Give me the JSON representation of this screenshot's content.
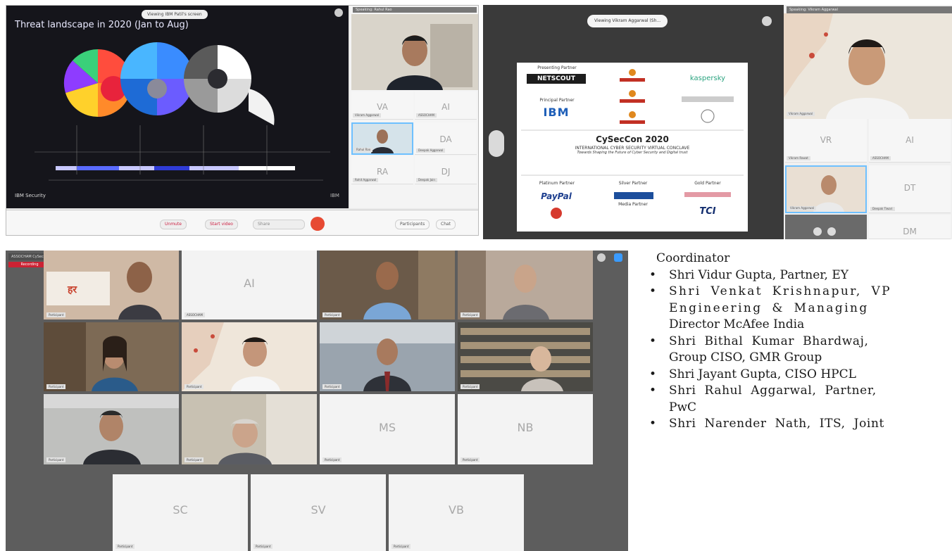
{
  "screenshot1": {
    "viewing_pill": "Viewing IBM Patil's screen",
    "slide_title": "Threat landscape in 2020 (Jan to Aug)",
    "slide_footer": "IBM Security",
    "slide_brand": "IBM",
    "side_header": "Speaking: Rahul Rao",
    "tiles": [
      {
        "initials": "VA",
        "name": "Vikram Aggarwal"
      },
      {
        "initials": "AI",
        "name": "ASSOCHAM"
      },
      {
        "initials": "",
        "name": "Rahul Rao"
      },
      {
        "initials": "DA",
        "name": "Deepak Aggarwal"
      },
      {
        "initials": "RA",
        "name": "Rohit Aggarwal"
      },
      {
        "initials": "DJ",
        "name": "Deepak Jain"
      }
    ],
    "toolbar": {
      "mute": "Unmute",
      "video": "Start video",
      "share": "Share",
      "participants": "Participants",
      "chat": "Chat"
    }
  },
  "screenshot2": {
    "viewing_pill": "Viewing Vikram Aggarwal (Sh...",
    "speaking": "Speaking: Vikram Aggarwal",
    "poster": {
      "row_heads": [
        "Presenting Partner",
        "Principal Partner",
        "Platinum Partner",
        "Gold Partner",
        "Silver Partner",
        "Media Partner"
      ],
      "sponsor_logos": [
        "NETSCOUT",
        "kaspersky",
        "IBM",
        "PayPal",
        "TCI"
      ],
      "event_title": "CySecCon 2020",
      "event_subtitle": "INTERNATIONAL CYBER SECURITY VIRTUAL CONCLAVE",
      "event_tagline": "Towards Shaping the Future of Cyber Security and Digital trust"
    },
    "tiles": [
      {
        "initials": "",
        "name": "Vikram Aggarwal"
      },
      {
        "initials": "VR",
        "name": "Vikram Rawat"
      },
      {
        "initials": "AI",
        "name": "ASSOCHAM"
      },
      {
        "initials": "DT",
        "name": "Deepak Tiwari"
      },
      {
        "initials": "",
        "name": "Vikram Aggarwal"
      },
      {
        "initials": "DM",
        "name": ""
      }
    ]
  },
  "screenshot3": {
    "header": "ASSOCHAM CySecCon 2020",
    "recording": "Recording",
    "grid": [
      {
        "initials": "",
        "name": "Participant"
      },
      {
        "initials": "AI",
        "name": "ASSOCHAM"
      },
      {
        "initials": "",
        "name": "Participant"
      },
      {
        "initials": "",
        "name": "Participant"
      },
      {
        "initials": "",
        "name": "Participant"
      },
      {
        "initials": "",
        "name": "Participant"
      },
      {
        "initials": "",
        "name": "Participant"
      },
      {
        "initials": "",
        "name": "Participant"
      },
      {
        "initials": "",
        "name": "Participant"
      },
      {
        "initials": "",
        "name": "Participant"
      },
      {
        "initials": "MS",
        "name": "Participant"
      },
      {
        "initials": "NB",
        "name": "Participant"
      },
      {
        "initials": "SC",
        "name": "Participant"
      },
      {
        "initials": "SV",
        "name": "Participant"
      },
      {
        "initials": "VB",
        "name": "Participant"
      }
    ]
  },
  "document": {
    "continuation": "Coordinator",
    "items": [
      {
        "lines": [
          "Shri Vidur Gupta, Partner, EY"
        ]
      },
      {
        "lines": [
          "Shri Venkat Krishnapur, VP",
          "Engineering & Managing",
          "Director McAfee India"
        ]
      },
      {
        "lines": [
          "Shri Bithal Kumar Bhardwaj,",
          "Group CISO, GMR Group"
        ]
      },
      {
        "lines": [
          "Shri Jayant Gupta, CISO HPCL"
        ]
      },
      {
        "lines": [
          "Shri Rahul Aggarwal, Partner,",
          "PwC"
        ]
      },
      {
        "lines": [
          "Shri Narender Nath, ITS, Joint"
        ]
      }
    ]
  },
  "colors": {
    "accent_red": "#e74a33",
    "slide_bg": "#15151b",
    "zoom_gray": "#5d5d5d"
  }
}
